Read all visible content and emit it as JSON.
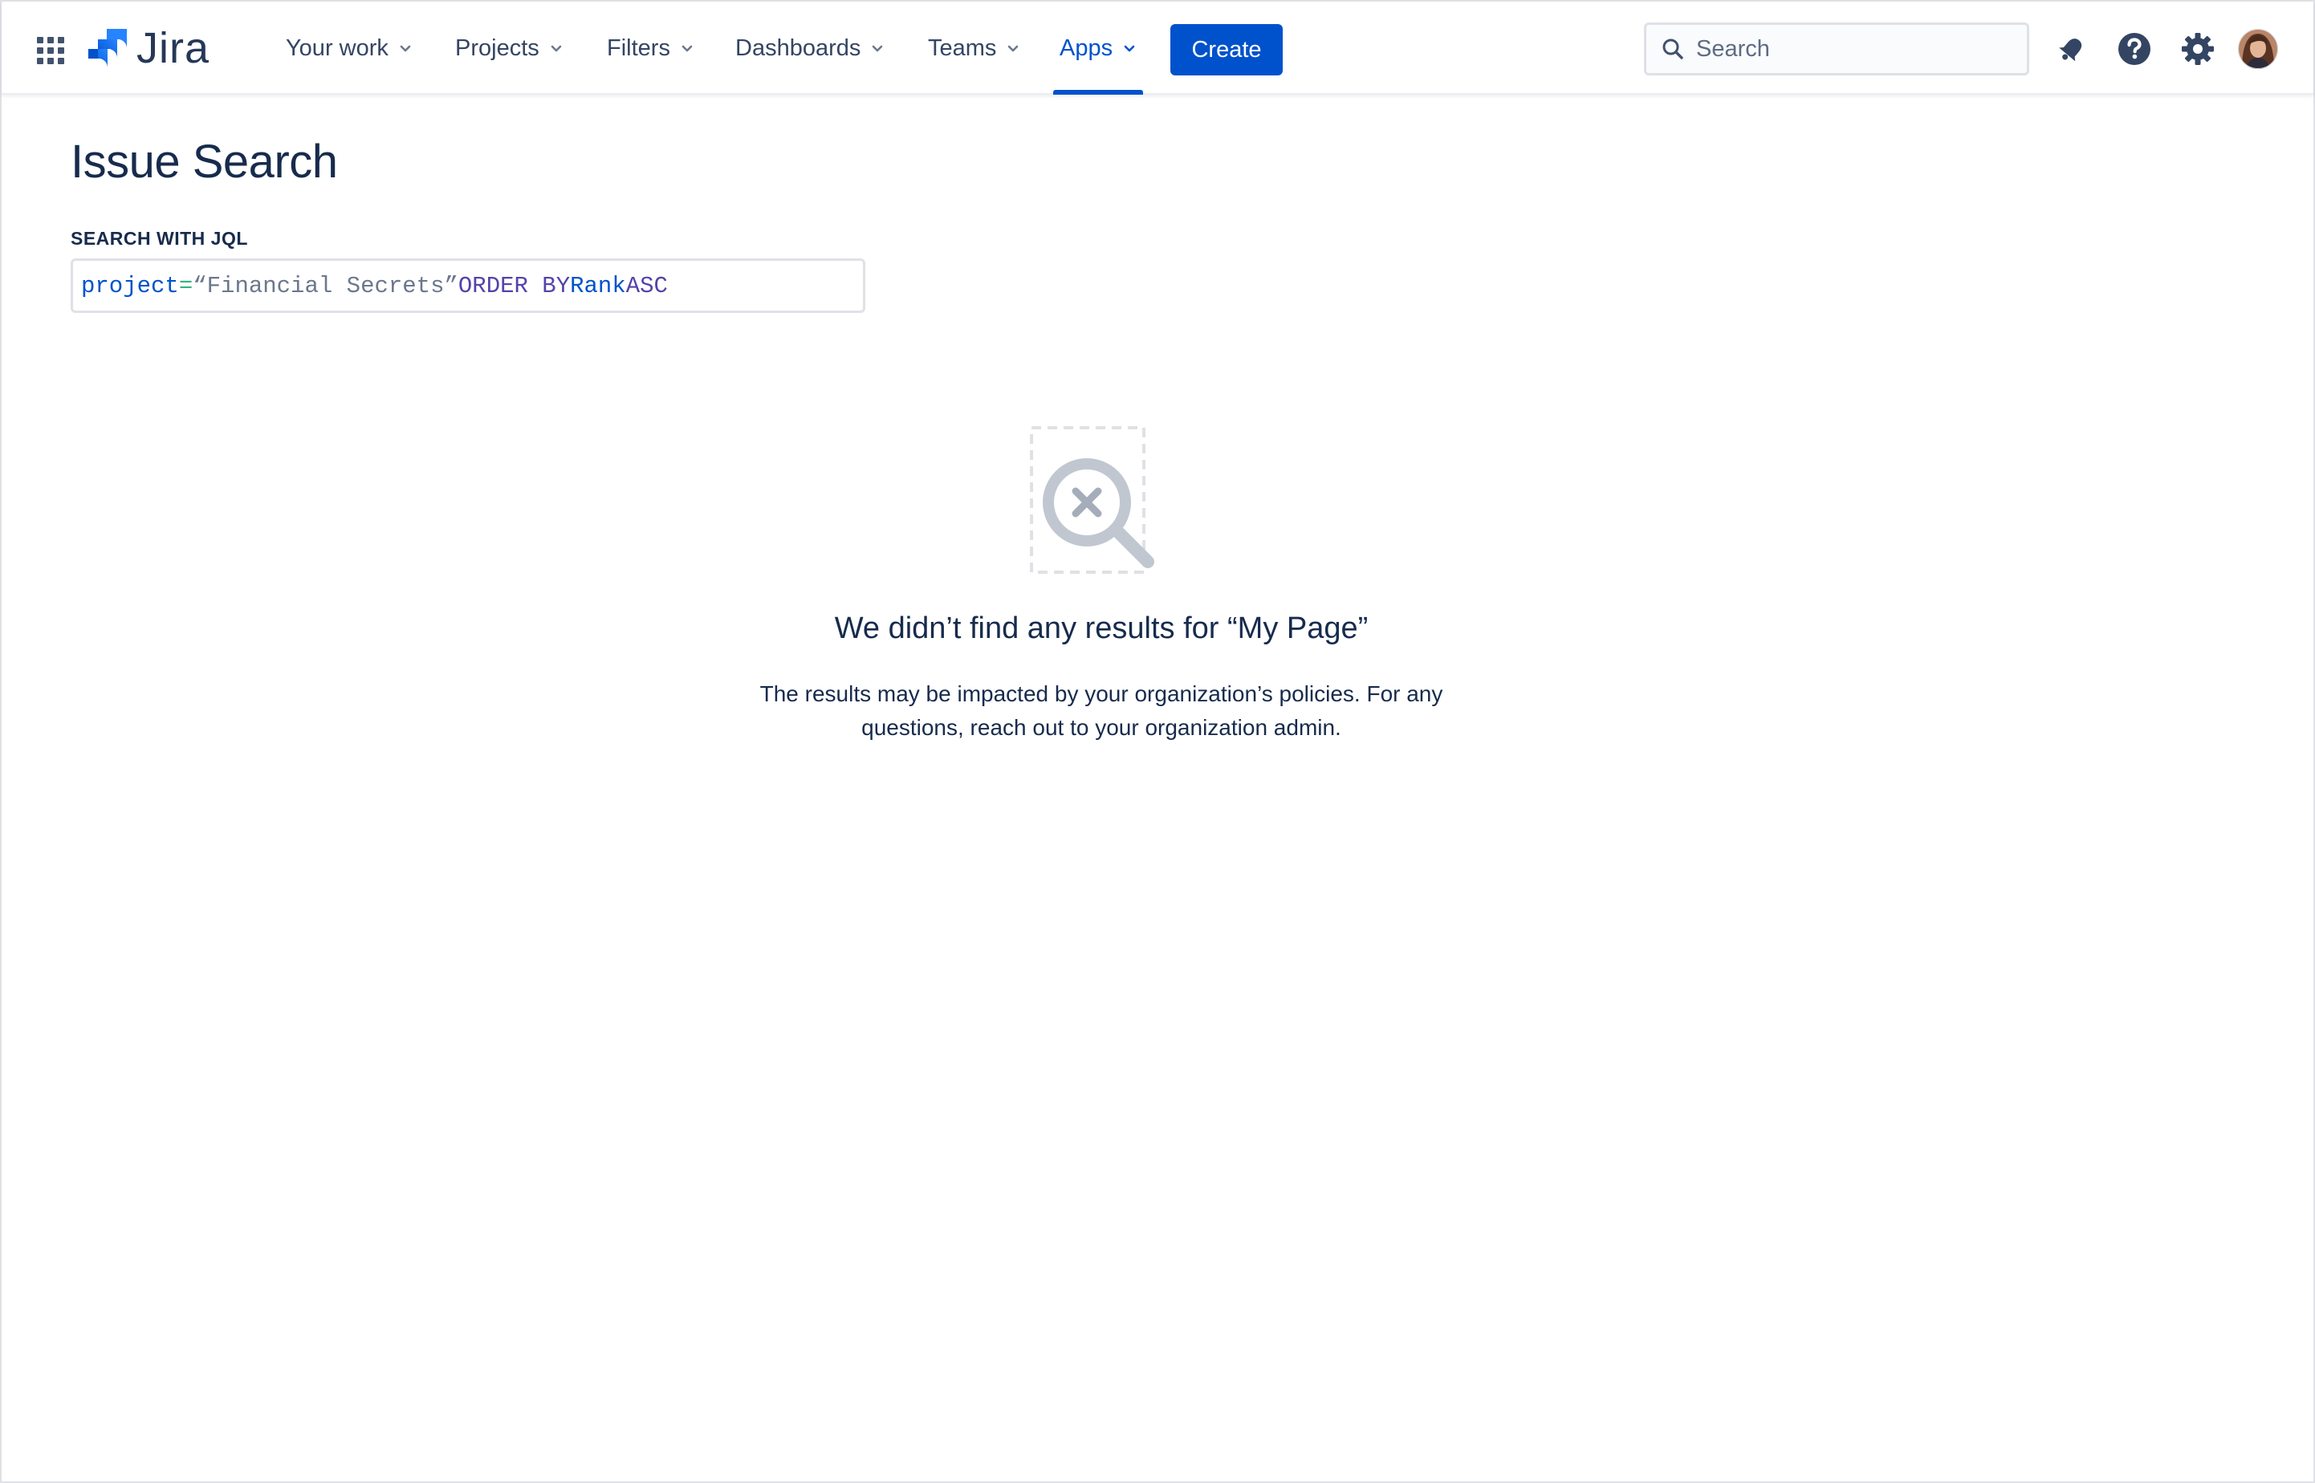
{
  "app": {
    "name": "Jira"
  },
  "nav": {
    "items": [
      {
        "label": "Your work"
      },
      {
        "label": "Projects"
      },
      {
        "label": "Filters"
      },
      {
        "label": "Dashboards"
      },
      {
        "label": "Teams"
      },
      {
        "label": "Apps",
        "active": true
      }
    ],
    "create_label": "Create",
    "search_placeholder": "Search"
  },
  "header_icons": [
    "notifications-icon",
    "help-icon",
    "settings-icon",
    "avatar"
  ],
  "page": {
    "title": "Issue Search",
    "jql_label": "SEARCH WITH JQL",
    "jql": {
      "field": "project",
      "operator": "=",
      "value": "“Financial Secrets”",
      "order_by": "ORDER BY",
      "order_field": "Rank",
      "direction": "ASC"
    }
  },
  "empty_state": {
    "title": "We didn’t find any results for “My Page”",
    "description": "The results may be impacted by your organization’s policies. For any questions, reach out to your organization admin."
  },
  "colors": {
    "brand": "#0052cc",
    "text": "#172b4d",
    "nav_text": "#344563",
    "jql_keyword": "#5243aa",
    "jql_operator": "#36b37e"
  }
}
